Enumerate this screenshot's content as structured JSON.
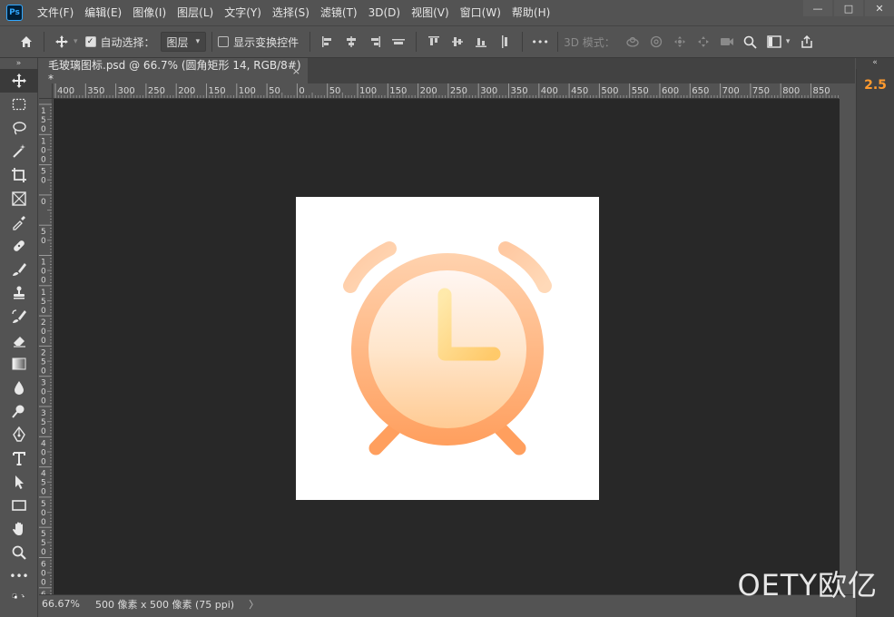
{
  "app": {
    "logo_text": "Ps"
  },
  "menu": [
    "文件(F)",
    "编辑(E)",
    "图像(I)",
    "图层(L)",
    "文字(Y)",
    "选择(S)",
    "滤镜(T)",
    "3D(D)",
    "视图(V)",
    "窗口(W)",
    "帮助(H)"
  ],
  "window_controls": {
    "minimize": "—",
    "maximize": "□",
    "close": "✕"
  },
  "options": {
    "auto_select_label": "自动选择：",
    "auto_select_checked": true,
    "auto_select_value": "图层",
    "show_transform_label": "显示变换控件",
    "show_transform_checked": false,
    "mode_3d_label": "3D 模式：",
    "more": "•••"
  },
  "document": {
    "tab_title": "毛玻璃图标.psd @ 66.7% (圆角矩形 14, RGB/8#) *",
    "close_glyph": "×"
  },
  "ruler": {
    "top_labels": [
      "400",
      "350",
      "300",
      "250",
      "200",
      "150",
      "100",
      "50",
      "0",
      "50",
      "100",
      "150",
      "200",
      "250",
      "300",
      "350",
      "400",
      "450",
      "500",
      "550",
      "600",
      "650",
      "700",
      "750",
      "800",
      "850"
    ],
    "left_labels": [
      "1 5 0",
      "1 0 0",
      "5 0",
      "0",
      "5 0",
      "1 0 0",
      "1 5 0",
      "2 0 0",
      "2 5 0",
      "3 0 0",
      "3 5 0",
      "4 0 0",
      "4 5 0",
      "5 0 0",
      "5 5 0",
      "6 0 0",
      "6 5 0"
    ]
  },
  "status": {
    "zoom": "66.67%",
    "doc_info": "500 像素 x 500 像素 (75 ppi)",
    "arrow": "〉"
  },
  "right_panel": {
    "badge": "2.5"
  },
  "watermark": "OETY欧亿",
  "colors": {
    "clock_orange_dark": "#ffa05a",
    "clock_orange_light": "#ffd0a0",
    "clock_face_top": "#fff4ee",
    "clock_face_bottom": "#ffcf99",
    "hand_gold": "#ffd580",
    "accent_badge": "#ff9a2e"
  }
}
